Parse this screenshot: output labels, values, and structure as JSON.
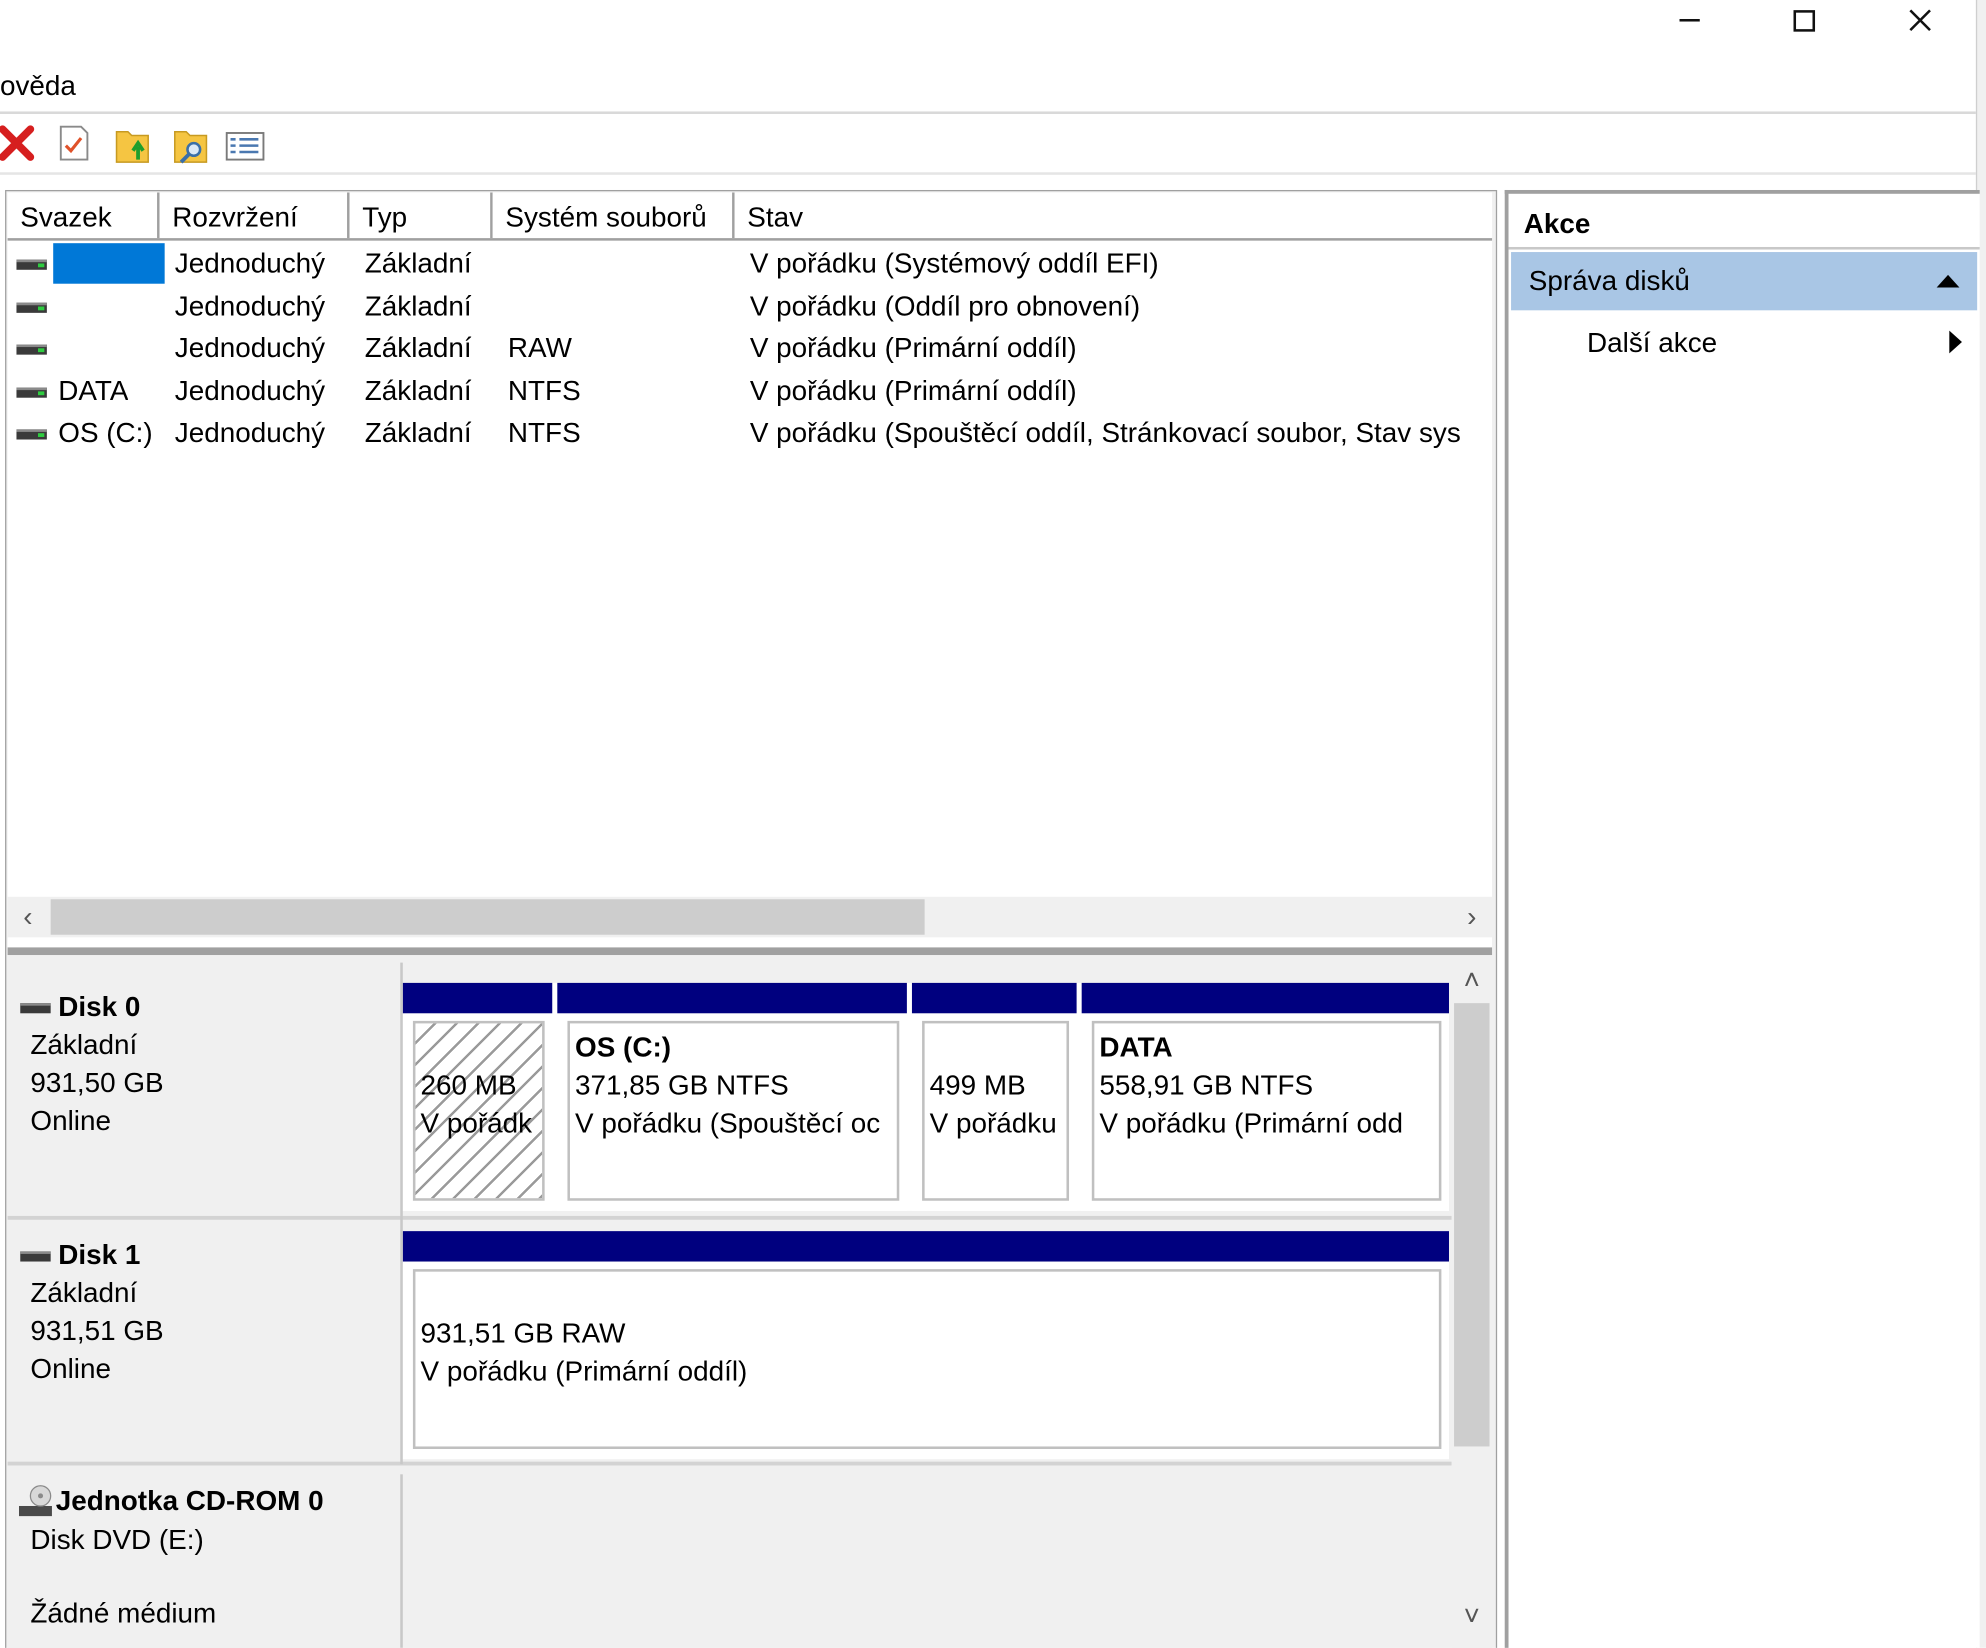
{
  "window": {
    "controls": [
      "minimize-icon",
      "maximize-icon",
      "close-icon"
    ]
  },
  "menu": {
    "help_partial": "ověda"
  },
  "toolbar": {
    "icons": [
      "delete-icon",
      "properties-icon",
      "open-folder-icon",
      "explore-icon",
      "view-list-icon"
    ],
    "colors": {
      "delete": "#d61f1f",
      "folder": "#f5c542"
    }
  },
  "volume_list": {
    "columns": [
      "Svazek",
      "Rozvržení",
      "Typ",
      "Systém souborů",
      "Stav"
    ],
    "rows": [
      {
        "volume": "",
        "layout": "Jednoduchý",
        "type": "Základní",
        "fs": "",
        "status": "V pořádku (Systémový oddíl EFI)",
        "selected": true
      },
      {
        "volume": "",
        "layout": "Jednoduchý",
        "type": "Základní",
        "fs": "",
        "status": "V pořádku (Oddíl pro obnovení)"
      },
      {
        "volume": "",
        "layout": "Jednoduchý",
        "type": "Základní",
        "fs": "RAW",
        "status": "V pořádku (Primární oddíl)"
      },
      {
        "volume": "DATA",
        "layout": "Jednoduchý",
        "type": "Základní",
        "fs": "NTFS",
        "status": "V pořádku (Primární oddíl)"
      },
      {
        "volume": "OS (C:)",
        "layout": "Jednoduchý",
        "type": "Základní",
        "fs": "NTFS",
        "status": "V pořádku (Spouštěcí oddíl, Stránkovací soubor, Stav sys"
      }
    ]
  },
  "disks": [
    {
      "name": "Disk 0",
      "kind": "Základní",
      "size": "931,50 GB",
      "state": "Online",
      "partitions": [
        {
          "title": "",
          "size": "260 MB",
          "status": "V pořádk"
        },
        {
          "title": "OS  (C:)",
          "size": "371,85 GB NTFS",
          "status": "V pořádku (Spouštěcí oc"
        },
        {
          "title": "",
          "size": "499 MB",
          "status": "V pořádku"
        },
        {
          "title": "DATA",
          "size": "558,91 GB NTFS",
          "status": "V pořádku (Primární odd"
        }
      ]
    },
    {
      "name": "Disk 1",
      "kind": "Základní",
      "size": "931,51 GB",
      "state": "Online",
      "partitions": [
        {
          "title": "",
          "size": "931,51 GB RAW",
          "status": "V pořádku (Primární oddíl)"
        }
      ]
    },
    {
      "name": "Jednotka CD-ROM 0",
      "kind": "Disk DVD (E:)",
      "size": "",
      "state": "Žádné médium"
    }
  ],
  "actions": {
    "title": "Akce",
    "section": "Správa disků",
    "item": "Další akce"
  },
  "colors": {
    "partition_bar": "#00007f",
    "selection": "#0078d7",
    "actions_header": "#a9c6e5"
  }
}
